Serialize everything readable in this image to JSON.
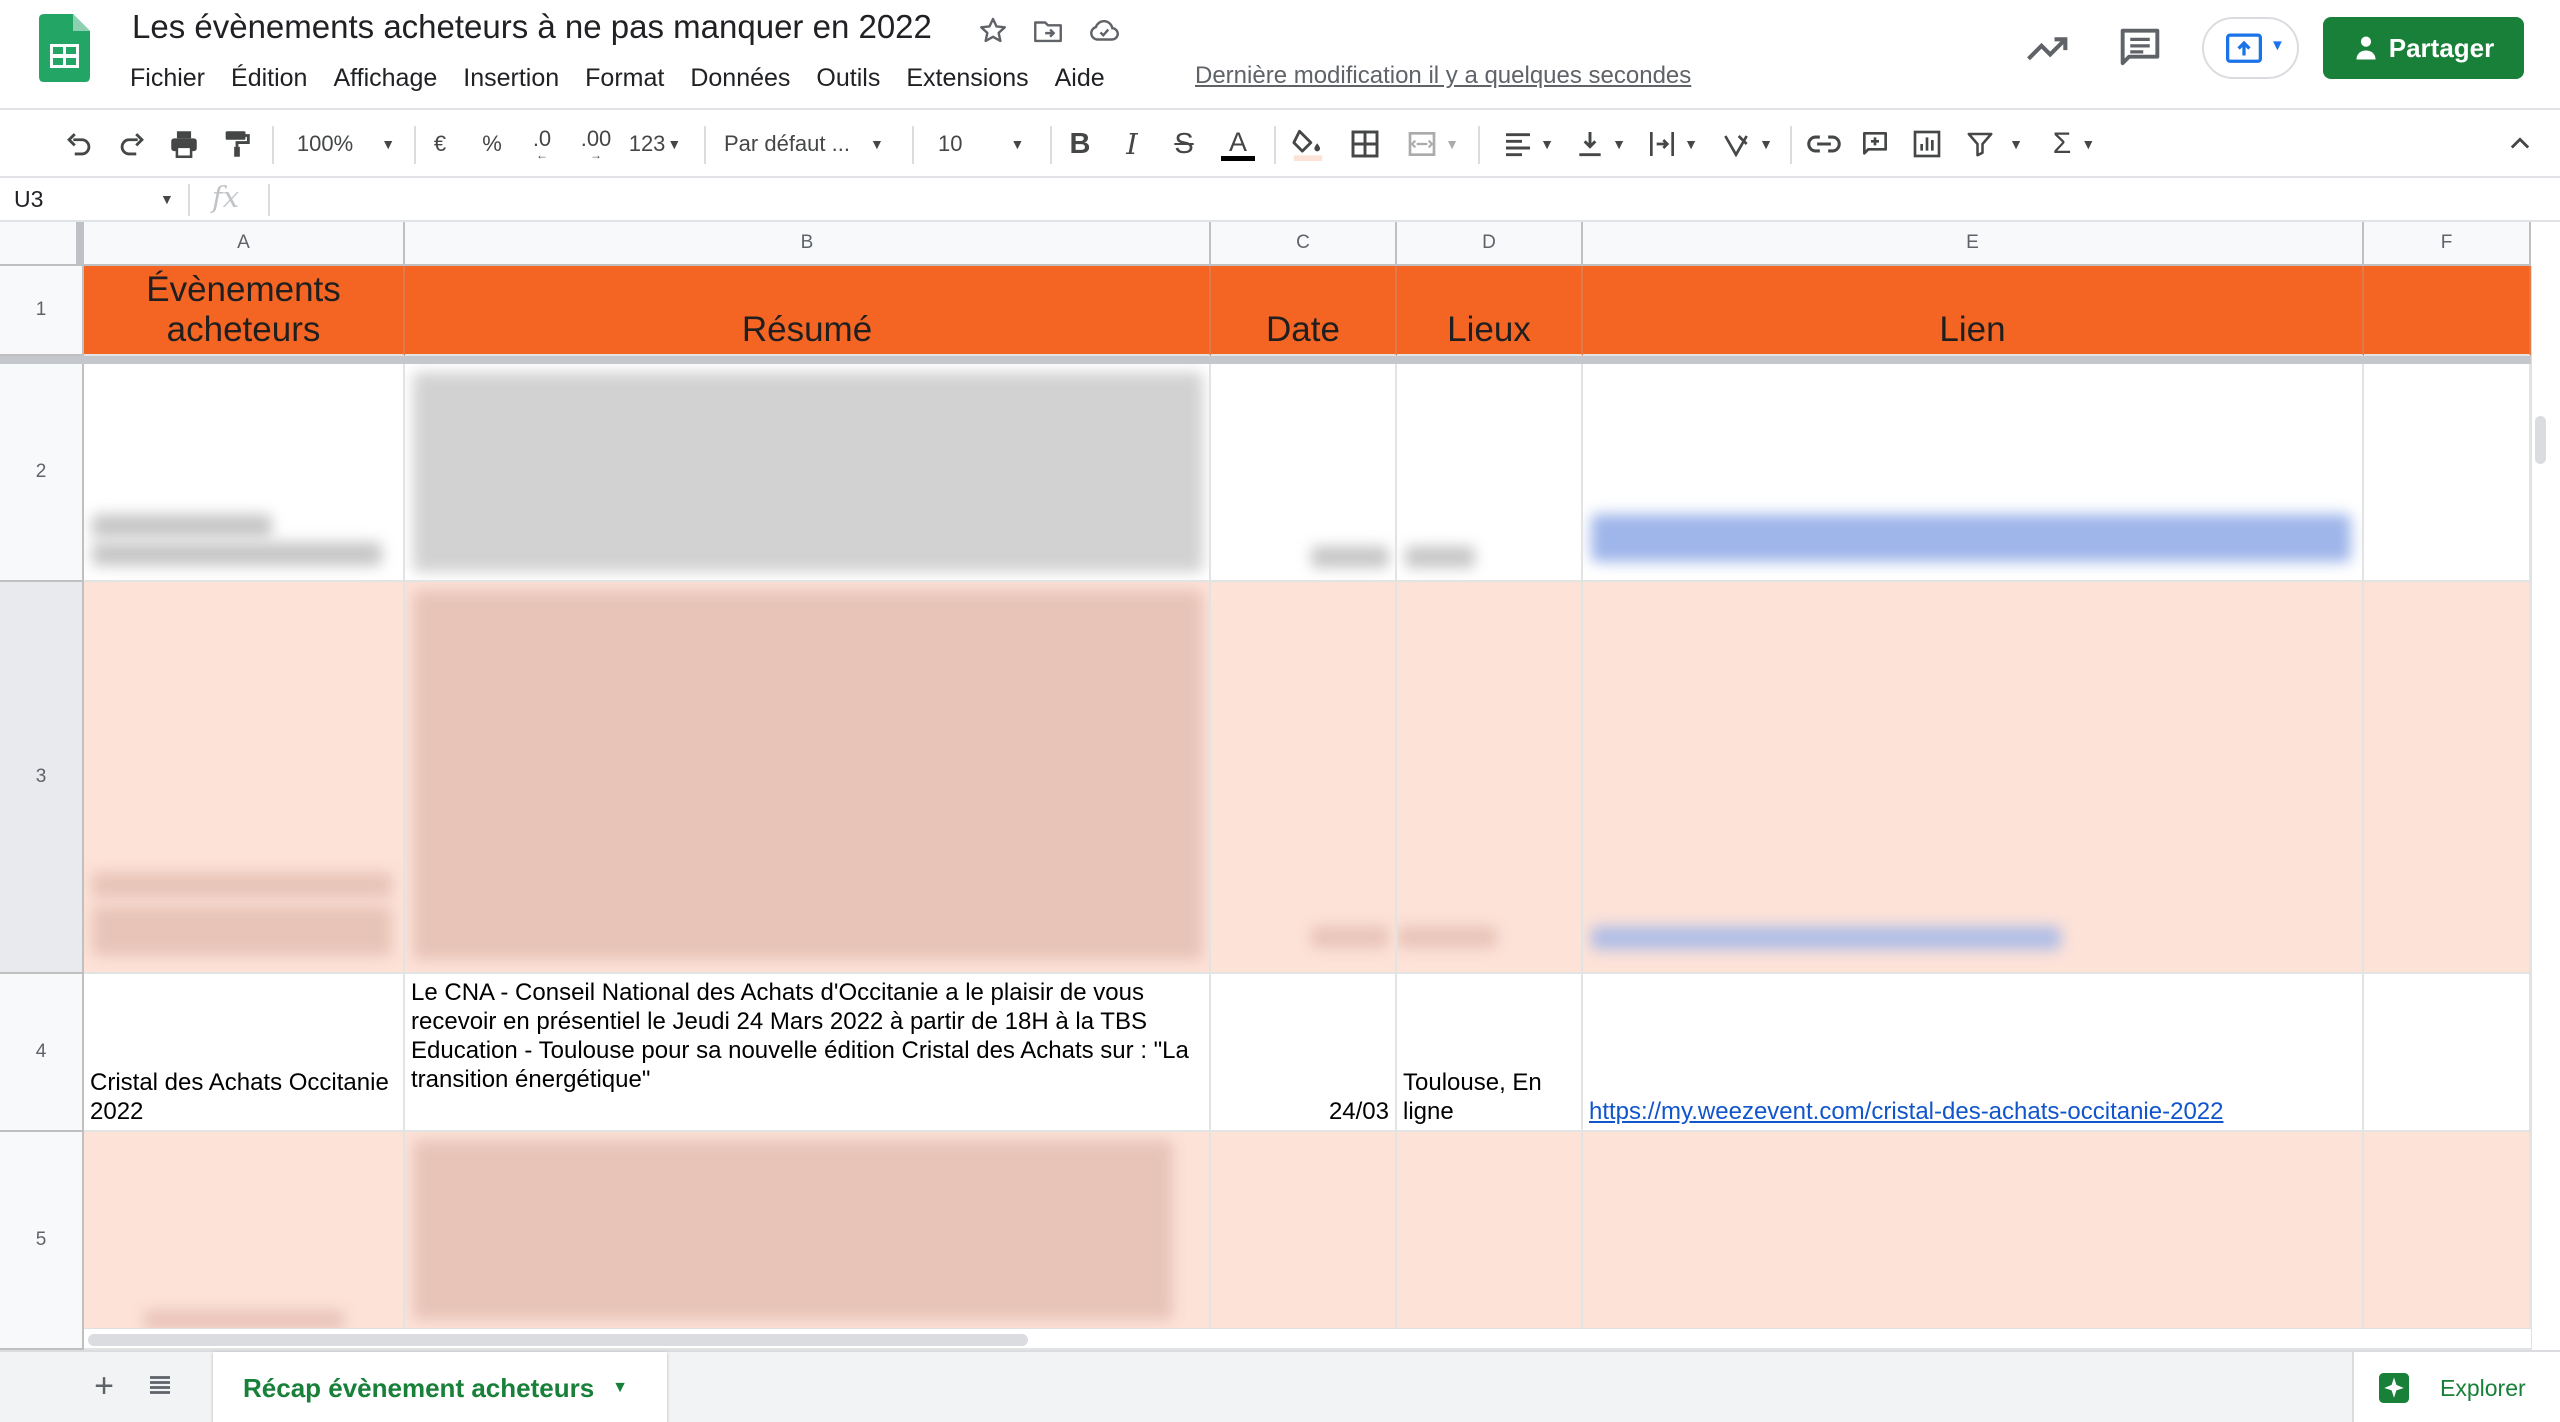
{
  "app": {
    "title": "Les évènements acheteurs à ne pas manquer en 2022",
    "last_edit": "Dernière modification il y a quelques secondes",
    "share_label": "Partager"
  },
  "menu": [
    "Fichier",
    "Édition",
    "Affichage",
    "Insertion",
    "Format",
    "Données",
    "Outils",
    "Extensions",
    "Aide"
  ],
  "toolbar": {
    "zoom": "100%",
    "currency": "€",
    "percent": "%",
    "dec_decrease": ".0",
    "dec_increase": ".00",
    "number_format": "123",
    "font": "Par défaut ...",
    "font_size": "10"
  },
  "formula_bar": {
    "cell_ref": "U3",
    "fx": "fx",
    "value": ""
  },
  "grid": {
    "columns": [
      "A",
      "B",
      "C",
      "D",
      "E",
      "F"
    ],
    "rows": [
      "1",
      "2",
      "3",
      "4",
      "5"
    ],
    "header_row": [
      "Évènements acheteurs",
      "Résumé",
      "Date",
      "Lieux",
      "Lien"
    ],
    "row4": {
      "event": "Cristal des Achats Occitanie 2022",
      "summary": "Le CNA - Conseil National des Achats d'Occitanie a le plaisir de vous recevoir en présentiel le Jeudi 24 Mars 2022 à partir de 18H à la TBS Education - Toulouse pour sa nouvelle édition Cristal des Achats sur : \"La transition énergétique\"",
      "date": "24/03",
      "location": "Toulouse, En ligne",
      "link": "https://my.weezevent.com/cristal-des-achats-occitanie-2022"
    }
  },
  "sheets": {
    "active": "Récap évènement acheteurs",
    "explore_label": "Explorer"
  },
  "colors": {
    "brand_green": "#188038",
    "header_orange": "#f46524",
    "band_peach": "#fde2d8",
    "link_blue": "#1155cc"
  },
  "icons": [
    "sheets-logo-icon",
    "star-icon",
    "move-folder-icon",
    "cloud-status-icon",
    "activity-trend-icon",
    "comments-icon",
    "present-icon",
    "person-add-icon",
    "undo-icon",
    "redo-icon",
    "print-icon",
    "paint-format-icon",
    "bold-icon",
    "italic-icon",
    "strikethrough-icon",
    "text-color-icon",
    "fill-color-icon",
    "borders-icon",
    "merge-cells-icon",
    "horizontal-align-icon",
    "vertical-align-icon",
    "text-wrap-icon",
    "text-rotation-icon",
    "link-icon",
    "comment-add-icon",
    "chart-icon",
    "filter-icon",
    "functions-icon",
    "collapse-icon",
    "add-sheet-icon",
    "all-sheets-icon",
    "explore-icon"
  ]
}
